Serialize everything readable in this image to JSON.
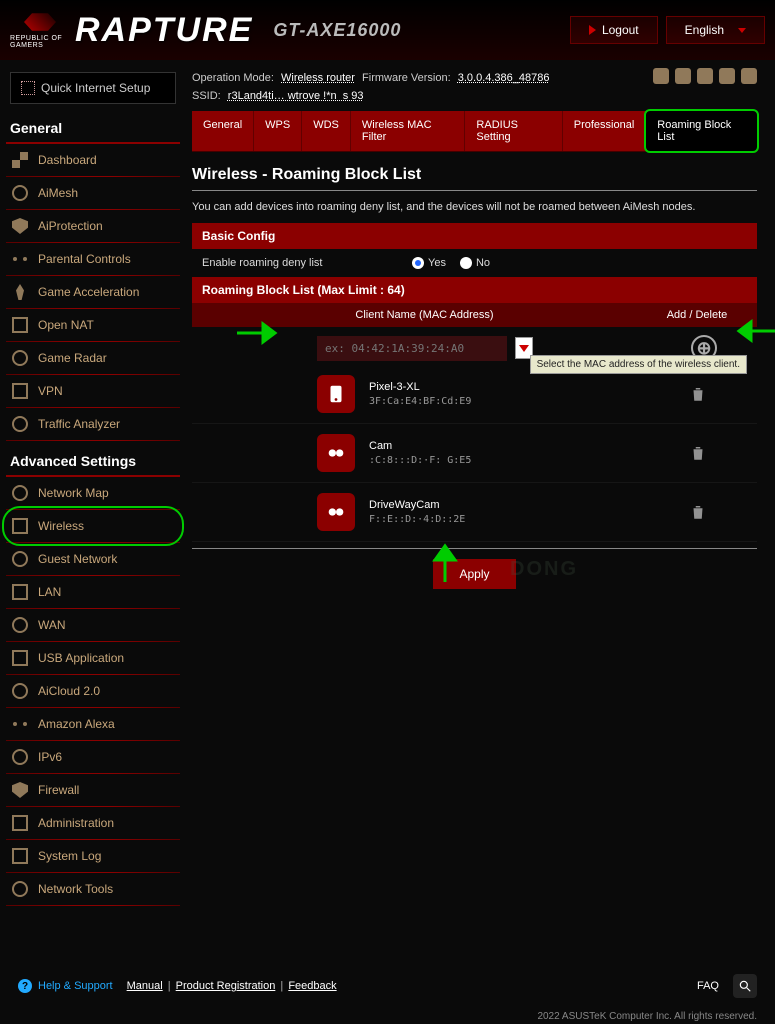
{
  "brand": "RAPTURE",
  "sub_brand": "REPUBLIC OF GAMERS",
  "model": "GT-AXE16000",
  "top": {
    "logout": "Logout",
    "language": "English"
  },
  "sysinfo": {
    "op_mode_label": "Operation Mode:",
    "op_mode": "Wireless router",
    "fw_label": "Firmware Version:",
    "fw": "3.0.0.4.386_48786",
    "ssid_label": "SSID:",
    "ssid": "r3Land4ti… wtrove !*n  s 93"
  },
  "tabs": [
    "General",
    "WPS",
    "WDS",
    "Wireless MAC Filter",
    "RADIUS Setting",
    "Professional",
    "Roaming Block List"
  ],
  "active_tab": 6,
  "page_title": "Wireless - Roaming Block List",
  "desc": "You can add devices into roaming deny list, and the devices will not be roamed between AiMesh nodes.",
  "basic_config": {
    "header": "Basic Config",
    "enable_label": "Enable roaming deny list",
    "yes": "Yes",
    "no": "No",
    "selected": "yes"
  },
  "block_list": {
    "header": "Roaming Block List (Max Limit : 64)",
    "col_name": "Client Name (MAC Address)",
    "col_action": "Add / Delete",
    "input_placeholder": "ex: 04:42:1A:39:24:A0",
    "tooltip": "Select the MAC address of the wireless client.",
    "devices": [
      {
        "name": "Pixel-3-XL",
        "mac": "3F:Ca:E4:BF:Cd:E9",
        "icon": "phone"
      },
      {
        "name": "Cam",
        "mac": ":C:8:::D:·F: G:E5",
        "icon": "cam"
      },
      {
        "name": "DriveWayCam",
        "mac": "F::E::D:·4:D::2E",
        "icon": "cam"
      }
    ]
  },
  "apply": "Apply",
  "sidebar": {
    "qis": "Quick Internet Setup",
    "groups": [
      {
        "title": "General",
        "items": [
          "Dashboard",
          "AiMesh",
          "AiProtection",
          "Parental Controls",
          "Game Acceleration",
          "Open NAT",
          "Game Radar",
          "VPN",
          "Traffic Analyzer"
        ]
      },
      {
        "title": "Advanced Settings",
        "items": [
          "Network Map",
          "Wireless",
          "Guest Network",
          "LAN",
          "WAN",
          "USB Application",
          "AiCloud 2.0",
          "Amazon Alexa",
          "IPv6",
          "Firewall",
          "Administration",
          "System Log",
          "Network Tools"
        ]
      }
    ]
  },
  "footer": {
    "help": "Help & Support",
    "manual": "Manual",
    "product_reg": "Product Registration",
    "feedback": "Feedback",
    "faq": "FAQ",
    "copyright": "2022 ASUSTeK Computer Inc. All rights reserved."
  }
}
